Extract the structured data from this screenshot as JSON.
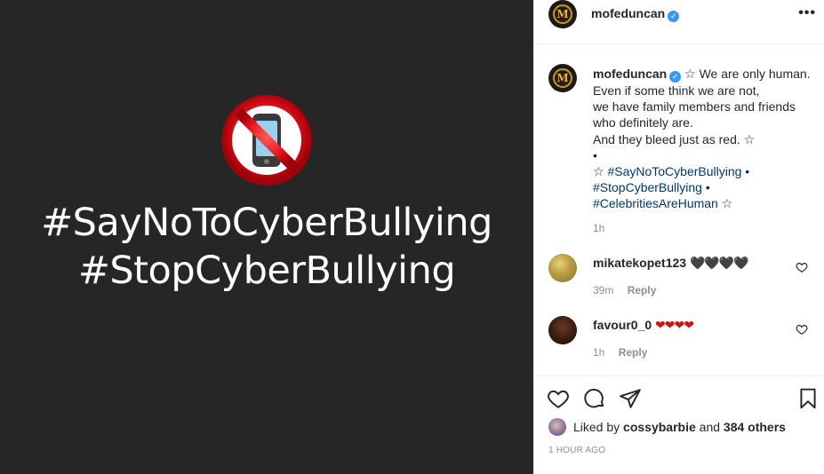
{
  "media": {
    "line1": "#SayNoToCyberBullying",
    "line2": "#StopCyberBullying",
    "icon": "no-mobile-phones-icon"
  },
  "header": {
    "username": "mofeduncan",
    "verified_icon": "verified-badge-icon",
    "more_label": "•••"
  },
  "caption": {
    "username": "mofeduncan",
    "lines": [
      "☆ We are only human.",
      "Even if some think we are not,",
      "we have family members and friends",
      "who definitely are.",
      "And they bleed just as red. ☆",
      "•"
    ],
    "tag_line_prefix": "☆ ",
    "tag1": "#SayNoToCyberBullying",
    "bullet": " •",
    "tag2": "#StopCyberBullying",
    "tag3": "#CelebritiesAreHuman",
    "suffix": " ☆",
    "time": "1h"
  },
  "comments": [
    {
      "username": "mikatekopet123",
      "text": "🖤🖤🖤🖤",
      "time": "39m",
      "reply": "Reply"
    },
    {
      "username": "favour0_0",
      "text": "❤❤❤❤",
      "time": "1h",
      "reply": "Reply"
    }
  ],
  "likes": {
    "prefix": "Liked by ",
    "user": "cossybarbie",
    "middle": " and ",
    "others": "384 others"
  },
  "timestamp": "1 HOUR AGO",
  "colors": {
    "media_bg": "#262626",
    "link": "#00376b",
    "verified": "#3897f0",
    "muted": "#8e8e8e",
    "prohibit_red": "#e0101a"
  }
}
